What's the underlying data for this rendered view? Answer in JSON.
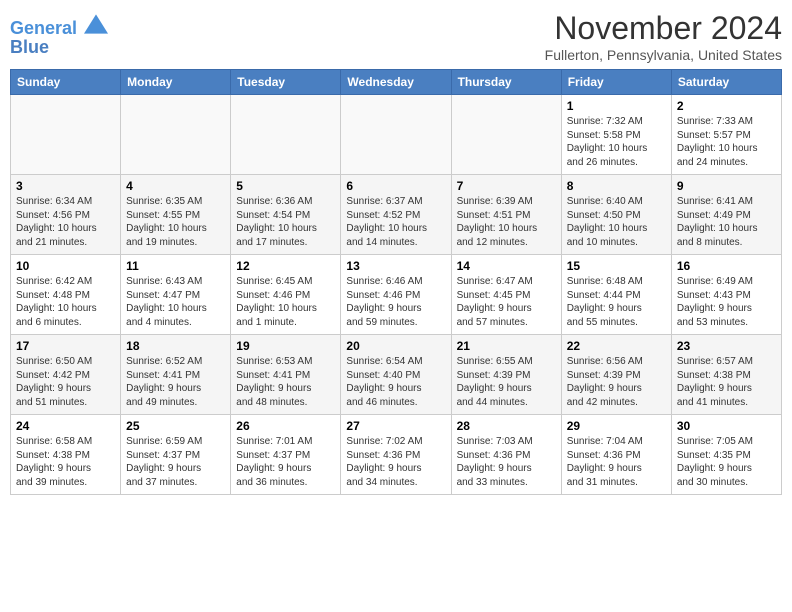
{
  "header": {
    "logo_line1": "General",
    "logo_line2": "Blue",
    "title": "November 2024",
    "subtitle": "Fullerton, Pennsylvania, United States"
  },
  "weekdays": [
    "Sunday",
    "Monday",
    "Tuesday",
    "Wednesday",
    "Thursday",
    "Friday",
    "Saturday"
  ],
  "weeks": [
    [
      {
        "day": "",
        "info": ""
      },
      {
        "day": "",
        "info": ""
      },
      {
        "day": "",
        "info": ""
      },
      {
        "day": "",
        "info": ""
      },
      {
        "day": "",
        "info": ""
      },
      {
        "day": "1",
        "info": "Sunrise: 7:32 AM\nSunset: 5:58 PM\nDaylight: 10 hours\nand 26 minutes."
      },
      {
        "day": "2",
        "info": "Sunrise: 7:33 AM\nSunset: 5:57 PM\nDaylight: 10 hours\nand 24 minutes."
      }
    ],
    [
      {
        "day": "3",
        "info": "Sunrise: 6:34 AM\nSunset: 4:56 PM\nDaylight: 10 hours\nand 21 minutes."
      },
      {
        "day": "4",
        "info": "Sunrise: 6:35 AM\nSunset: 4:55 PM\nDaylight: 10 hours\nand 19 minutes."
      },
      {
        "day": "5",
        "info": "Sunrise: 6:36 AM\nSunset: 4:54 PM\nDaylight: 10 hours\nand 17 minutes."
      },
      {
        "day": "6",
        "info": "Sunrise: 6:37 AM\nSunset: 4:52 PM\nDaylight: 10 hours\nand 14 minutes."
      },
      {
        "day": "7",
        "info": "Sunrise: 6:39 AM\nSunset: 4:51 PM\nDaylight: 10 hours\nand 12 minutes."
      },
      {
        "day": "8",
        "info": "Sunrise: 6:40 AM\nSunset: 4:50 PM\nDaylight: 10 hours\nand 10 minutes."
      },
      {
        "day": "9",
        "info": "Sunrise: 6:41 AM\nSunset: 4:49 PM\nDaylight: 10 hours\nand 8 minutes."
      }
    ],
    [
      {
        "day": "10",
        "info": "Sunrise: 6:42 AM\nSunset: 4:48 PM\nDaylight: 10 hours\nand 6 minutes."
      },
      {
        "day": "11",
        "info": "Sunrise: 6:43 AM\nSunset: 4:47 PM\nDaylight: 10 hours\nand 4 minutes."
      },
      {
        "day": "12",
        "info": "Sunrise: 6:45 AM\nSunset: 4:46 PM\nDaylight: 10 hours\nand 1 minute."
      },
      {
        "day": "13",
        "info": "Sunrise: 6:46 AM\nSunset: 4:46 PM\nDaylight: 9 hours\nand 59 minutes."
      },
      {
        "day": "14",
        "info": "Sunrise: 6:47 AM\nSunset: 4:45 PM\nDaylight: 9 hours\nand 57 minutes."
      },
      {
        "day": "15",
        "info": "Sunrise: 6:48 AM\nSunset: 4:44 PM\nDaylight: 9 hours\nand 55 minutes."
      },
      {
        "day": "16",
        "info": "Sunrise: 6:49 AM\nSunset: 4:43 PM\nDaylight: 9 hours\nand 53 minutes."
      }
    ],
    [
      {
        "day": "17",
        "info": "Sunrise: 6:50 AM\nSunset: 4:42 PM\nDaylight: 9 hours\nand 51 minutes."
      },
      {
        "day": "18",
        "info": "Sunrise: 6:52 AM\nSunset: 4:41 PM\nDaylight: 9 hours\nand 49 minutes."
      },
      {
        "day": "19",
        "info": "Sunrise: 6:53 AM\nSunset: 4:41 PM\nDaylight: 9 hours\nand 48 minutes."
      },
      {
        "day": "20",
        "info": "Sunrise: 6:54 AM\nSunset: 4:40 PM\nDaylight: 9 hours\nand 46 minutes."
      },
      {
        "day": "21",
        "info": "Sunrise: 6:55 AM\nSunset: 4:39 PM\nDaylight: 9 hours\nand 44 minutes."
      },
      {
        "day": "22",
        "info": "Sunrise: 6:56 AM\nSunset: 4:39 PM\nDaylight: 9 hours\nand 42 minutes."
      },
      {
        "day": "23",
        "info": "Sunrise: 6:57 AM\nSunset: 4:38 PM\nDaylight: 9 hours\nand 41 minutes."
      }
    ],
    [
      {
        "day": "24",
        "info": "Sunrise: 6:58 AM\nSunset: 4:38 PM\nDaylight: 9 hours\nand 39 minutes."
      },
      {
        "day": "25",
        "info": "Sunrise: 6:59 AM\nSunset: 4:37 PM\nDaylight: 9 hours\nand 37 minutes."
      },
      {
        "day": "26",
        "info": "Sunrise: 7:01 AM\nSunset: 4:37 PM\nDaylight: 9 hours\nand 36 minutes."
      },
      {
        "day": "27",
        "info": "Sunrise: 7:02 AM\nSunset: 4:36 PM\nDaylight: 9 hours\nand 34 minutes."
      },
      {
        "day": "28",
        "info": "Sunrise: 7:03 AM\nSunset: 4:36 PM\nDaylight: 9 hours\nand 33 minutes."
      },
      {
        "day": "29",
        "info": "Sunrise: 7:04 AM\nSunset: 4:36 PM\nDaylight: 9 hours\nand 31 minutes."
      },
      {
        "day": "30",
        "info": "Sunrise: 7:05 AM\nSunset: 4:35 PM\nDaylight: 9 hours\nand 30 minutes."
      }
    ]
  ]
}
